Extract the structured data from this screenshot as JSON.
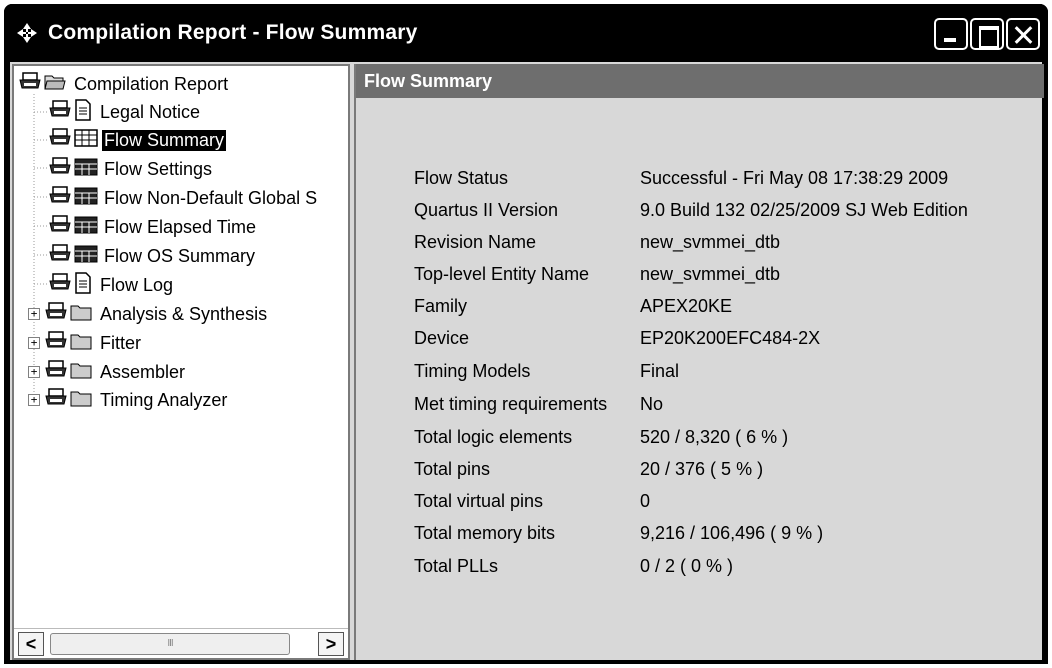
{
  "window": {
    "title": "Compilation Report - Flow Summary"
  },
  "tree": {
    "root": "Compilation Report",
    "items": [
      {
        "label": "Legal Notice",
        "icon": "document-icon",
        "expandable": false,
        "selected": false
      },
      {
        "label": "Flow Summary",
        "icon": "table-icon",
        "expandable": false,
        "selected": true
      },
      {
        "label": "Flow Settings",
        "icon": "table-icon",
        "expandable": false,
        "selected": false
      },
      {
        "label": "Flow Non-Default Global S",
        "icon": "table-icon",
        "expandable": false,
        "selected": false
      },
      {
        "label": "Flow Elapsed Time",
        "icon": "table-icon",
        "expandable": false,
        "selected": false
      },
      {
        "label": "Flow OS Summary",
        "icon": "table-icon",
        "expandable": false,
        "selected": false
      },
      {
        "label": "Flow Log",
        "icon": "document-icon",
        "expandable": false,
        "selected": false
      },
      {
        "label": "Analysis & Synthesis",
        "icon": "folder-icon",
        "expandable": true,
        "selected": false
      },
      {
        "label": "Fitter",
        "icon": "folder-icon",
        "expandable": true,
        "selected": false
      },
      {
        "label": "Assembler",
        "icon": "folder-icon",
        "expandable": true,
        "selected": false
      },
      {
        "label": "Timing Analyzer",
        "icon": "folder-icon",
        "expandable": true,
        "selected": false
      }
    ],
    "scroll_thumb_label": "III"
  },
  "content": {
    "header": "Flow Summary",
    "rows": [
      {
        "key": "Flow Status",
        "value": "Successful - Fri May 08 17:38:29 2009"
      },
      {
        "key": "Quartus II Version",
        "value": "9.0 Build 132 02/25/2009 SJ Web Edition"
      },
      {
        "key": "Revision Name",
        "value": "new_svmmei_dtb"
      },
      {
        "key": "Top-level Entity Name",
        "value": "new_svmmei_dtb"
      },
      {
        "key": "Family",
        "value": "APEX20KE"
      },
      {
        "key": "Device",
        "value": "EP20K200EFC484-2X"
      },
      {
        "key": "Timing Models",
        "value": "Final"
      },
      {
        "key": "Met timing requirements",
        "value": "No"
      },
      {
        "key": "Total logic elements",
        "value": "520 / 8,320 ( 6 % )"
      },
      {
        "key": "Total pins",
        "value": "20 / 376 ( 5 % )"
      },
      {
        "key": "Total virtual pins",
        "value": "0"
      },
      {
        "key": "Total memory bits",
        "value": "9,216 / 106,496 ( 9 % )"
      },
      {
        "key": "Total PLLs",
        "value": "0 / 2 ( 0 % )"
      }
    ]
  }
}
